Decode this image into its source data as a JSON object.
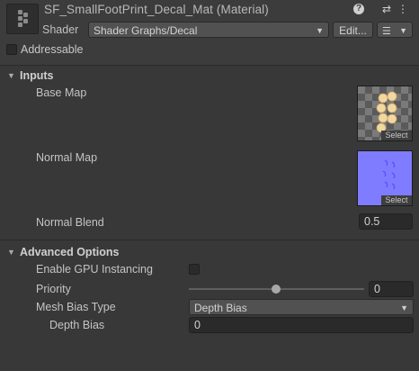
{
  "header": {
    "title": "SF_SmallFootPrint_Decal_Mat (Material)",
    "help_icon": "?",
    "settings_icon": "⇄",
    "menu_icon": "⋮",
    "shader_label": "Shader",
    "shader_value": "Shader Graphs/Decal",
    "edit_label": "Edit...",
    "list_icon": "☰",
    "addressable_label": "Addressable",
    "addressable_checked": false
  },
  "inputs": {
    "title": "Inputs",
    "base_map_label": "Base Map",
    "normal_map_label": "Normal Map",
    "select_label": "Select",
    "normal_blend_label": "Normal Blend",
    "normal_blend_value": "0.5"
  },
  "advanced": {
    "title": "Advanced Options",
    "gpu_instancing_label": "Enable GPU Instancing",
    "gpu_instancing_checked": false,
    "priority_label": "Priority",
    "priority_value": "0",
    "mesh_bias_type_label": "Mesh Bias Type",
    "mesh_bias_type_value": "Depth Bias",
    "depth_bias_label": "Depth Bias",
    "depth_bias_value": "0"
  },
  "colors": {
    "panel_bg": "#383838",
    "header_bg": "#3c3c3c",
    "normal_map_bg": "#7f7cff",
    "base_map_footprint": "#f1d8a0"
  }
}
